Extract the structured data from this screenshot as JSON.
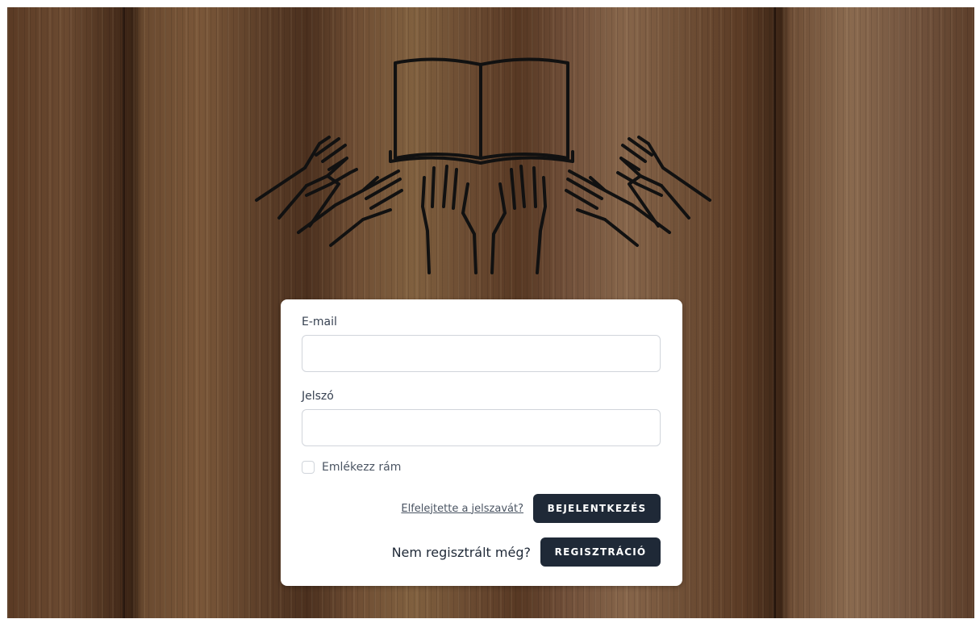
{
  "logo": {
    "icon": "book-with-raised-hands-icon"
  },
  "form": {
    "email_label": "E-mail",
    "email_value": "",
    "password_label": "Jelszó",
    "password_value": "",
    "remember_label": "Emlékezz rám",
    "remember_checked": false,
    "forgot_link": "Elfelejtette a jelszavát?",
    "login_button": "BEJELENTKEZÉS",
    "not_registered_text": "Nem regisztrált még?",
    "register_button": "REGISZTRÁCIÓ"
  },
  "colors": {
    "button_bg": "#1f2937",
    "card_bg": "#ffffff",
    "wood": "#6b4a31"
  }
}
